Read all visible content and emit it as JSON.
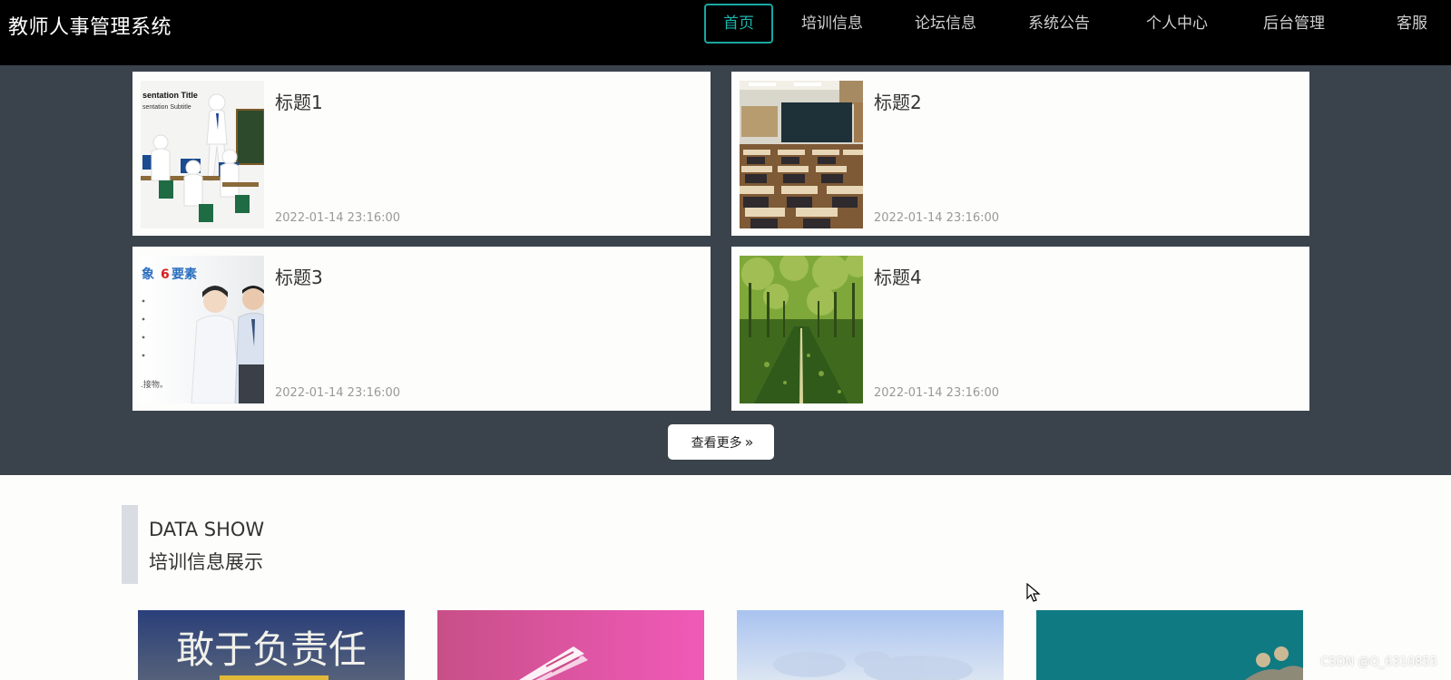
{
  "header": {
    "site_title": "教师人事管理系统",
    "nav": [
      {
        "label": "首页",
        "active": true
      },
      {
        "label": "培训信息",
        "active": false
      },
      {
        "label": "论坛信息",
        "active": false
      },
      {
        "label": "系统公告",
        "active": false
      },
      {
        "label": "个人中心",
        "active": false
      },
      {
        "label": "后台管理",
        "active": false
      },
      {
        "label": "客服",
        "active": false
      }
    ]
  },
  "news": {
    "items": [
      {
        "title": "标题1",
        "date": "2022-01-14 23:16:00",
        "image": "presentation-teacher-image",
        "image_text": [
          "sentation Title",
          "sentation Subtitle"
        ]
      },
      {
        "title": "标题2",
        "date": "2022-01-14 23:16:00",
        "image": "classroom-image"
      },
      {
        "title": "标题3",
        "date": "2022-01-14 23:16:00",
        "image": "business-people-image",
        "image_text": [
          "象",
          "6",
          "要素",
          ".接物。"
        ]
      },
      {
        "title": "标题4",
        "date": "2022-01-14 23:16:00",
        "image": "tree-lined-path-image"
      }
    ],
    "more_label": "查看更多",
    "more_icon": "double-chevron-right-icon"
  },
  "data_show": {
    "heading_en": "DATA SHOW",
    "heading_cn": "培训信息展示",
    "tiles": [
      {
        "image": "responsibility-banner-image",
        "text": "敢于负责任"
      },
      {
        "image": "pink-book-image"
      },
      {
        "image": "blue-sky-image"
      },
      {
        "image": "teal-people-image"
      }
    ]
  },
  "watermark": "CSDN @Q_6310855",
  "colors": {
    "header_bg": "#000000",
    "accent": "#19a7a1",
    "section_bg": "#3a434c",
    "page_bg": "#fdfdfb"
  }
}
